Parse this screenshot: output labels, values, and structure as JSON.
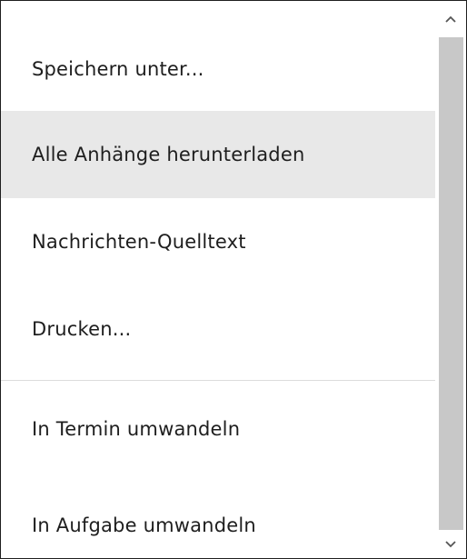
{
  "menu": {
    "items": [
      {
        "label": "Speichern unter..."
      },
      {
        "label": "Alle Anhänge herunterladen"
      },
      {
        "label": "Nachrichten-Quelltext"
      },
      {
        "label": "Drucken..."
      },
      {
        "label": "In Termin umwandeln"
      },
      {
        "label": "In Aufgabe umwandeln"
      }
    ]
  },
  "scrollbar": {
    "up_icon": "chevron-up-icon",
    "down_icon": "chevron-down-icon",
    "thumb_color": "#c8c8c8"
  },
  "colors": {
    "hover_background": "#e8e8e8",
    "text": "#1e1e1e",
    "border": "#1f1f1f"
  }
}
